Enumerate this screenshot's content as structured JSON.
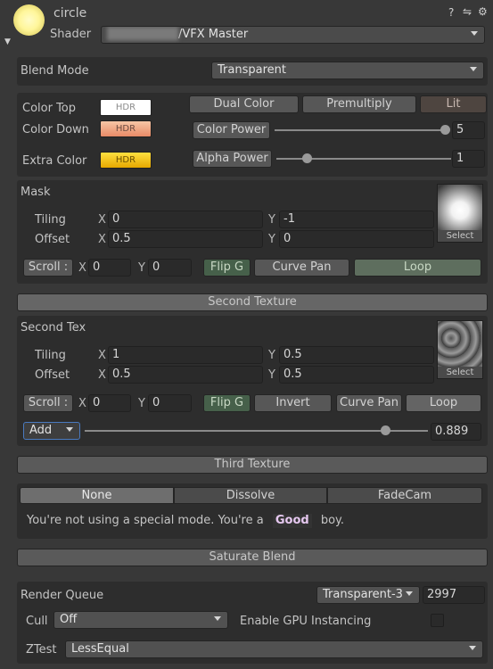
{
  "header": {
    "title": "circle",
    "shader_label": "Shader",
    "shader_prefix_blurred": "████████",
    "shader_value": "/VFX Master"
  },
  "blend": {
    "label": "Blend Mode",
    "value": "Transparent"
  },
  "colors": {
    "top_label": "Color Top",
    "down_label": "Color Down",
    "extra_label": "Extra Color",
    "hdr": "HDR",
    "top_color": "#ffffff",
    "down_color": "#f0a884",
    "extra_color": "#f2c200"
  },
  "toggles": {
    "dual_color": "Dual Color",
    "premultiply": "Premultiply",
    "lit": "Lit"
  },
  "color_power": {
    "label": "Color Power",
    "value": "5",
    "fraction": 1.0
  },
  "alpha_power": {
    "label": "Alpha Power",
    "value": "1",
    "fraction": 0.17
  },
  "mask": {
    "title": "Mask",
    "tiling_label": "Tiling",
    "offset_label": "Offset",
    "x": "X",
    "y": "Y",
    "tiling_x": "0",
    "tiling_y": "-1",
    "offset_x": "0.5",
    "offset_y": "0",
    "select": "Select",
    "scroll_label": "Scroll :",
    "scroll_x": "0",
    "scroll_y": "0",
    "flip_g": "Flip G",
    "curve_pan": "Curve Pan",
    "loop": "Loop"
  },
  "second": {
    "section": "Second Texture",
    "title": "Second Tex",
    "tiling_label": "Tiling",
    "offset_label": "Offset",
    "x": "X",
    "y": "Y",
    "tiling_x": "1",
    "tiling_y": "0.5",
    "offset_x": "0.5",
    "offset_y": "0.5",
    "select": "Select",
    "scroll_label": "Scroll :",
    "scroll_x": "0",
    "scroll_y": "0",
    "flip_g": "Flip G",
    "invert": "Invert",
    "curve_pan": "Curve Pan",
    "loop": "Loop",
    "blend_op": "Add",
    "blend_value": "0.889",
    "blend_fraction": 0.889
  },
  "third": {
    "section": "Third Texture"
  },
  "modes": {
    "tabs": [
      "None",
      "Dissolve",
      "FadeCam"
    ],
    "message_pre": "You're not using a special mode. You're a",
    "message_word": "Good",
    "message_post": "boy."
  },
  "saturate": {
    "section": "Saturate Blend"
  },
  "render": {
    "queue_label": "Render Queue",
    "queue_preset": "Transparent-3",
    "queue_value": "2997",
    "cull_label": "Cull",
    "cull_value": "Off",
    "gpu_label": "Enable GPU Instancing",
    "ztest_label": "ZTest",
    "ztest_value": "LessEqual"
  },
  "icons": [
    "help-icon",
    "sliders-icon",
    "gear-icon",
    "foldout-arrow-icon",
    "dropdown-caret-icon"
  ]
}
